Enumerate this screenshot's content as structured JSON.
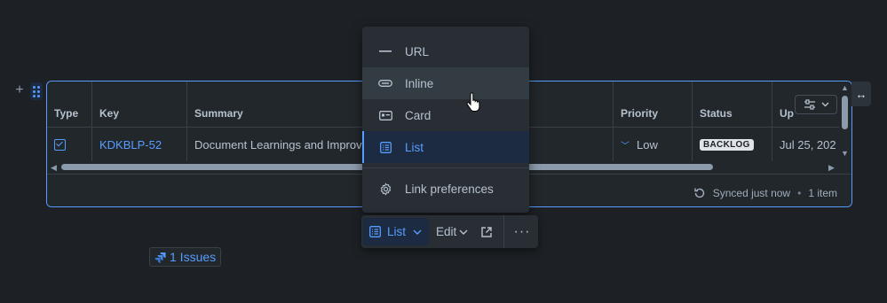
{
  "menu": {
    "items": [
      {
        "label": "URL",
        "icon": "url-dash-icon"
      },
      {
        "label": "Inline",
        "icon": "inline-icon"
      },
      {
        "label": "Card",
        "icon": "card-icon"
      },
      {
        "label": "List",
        "icon": "list-icon"
      }
    ],
    "preferences_label": "Link preferences"
  },
  "table": {
    "headers": [
      "Type",
      "Key",
      "Summary",
      "Priority",
      "Status",
      "Up"
    ],
    "row": {
      "key": "KDKBLP-52",
      "summary": "Document Learnings and Improv",
      "priority": "Low",
      "status": "BACKLOG",
      "updated": "Jul 25, 202"
    },
    "footer": {
      "sync_text": "Synced just now",
      "dot": "•",
      "count_text": "1 item"
    }
  },
  "toolbar": {
    "view_label": "List",
    "edit_label": "Edit"
  },
  "issues_chip": {
    "label": "1 Issues"
  },
  "colors": {
    "accent": "#579dff",
    "background": "#1d2125",
    "surface": "#22272b",
    "menu_bg": "#282e33"
  }
}
